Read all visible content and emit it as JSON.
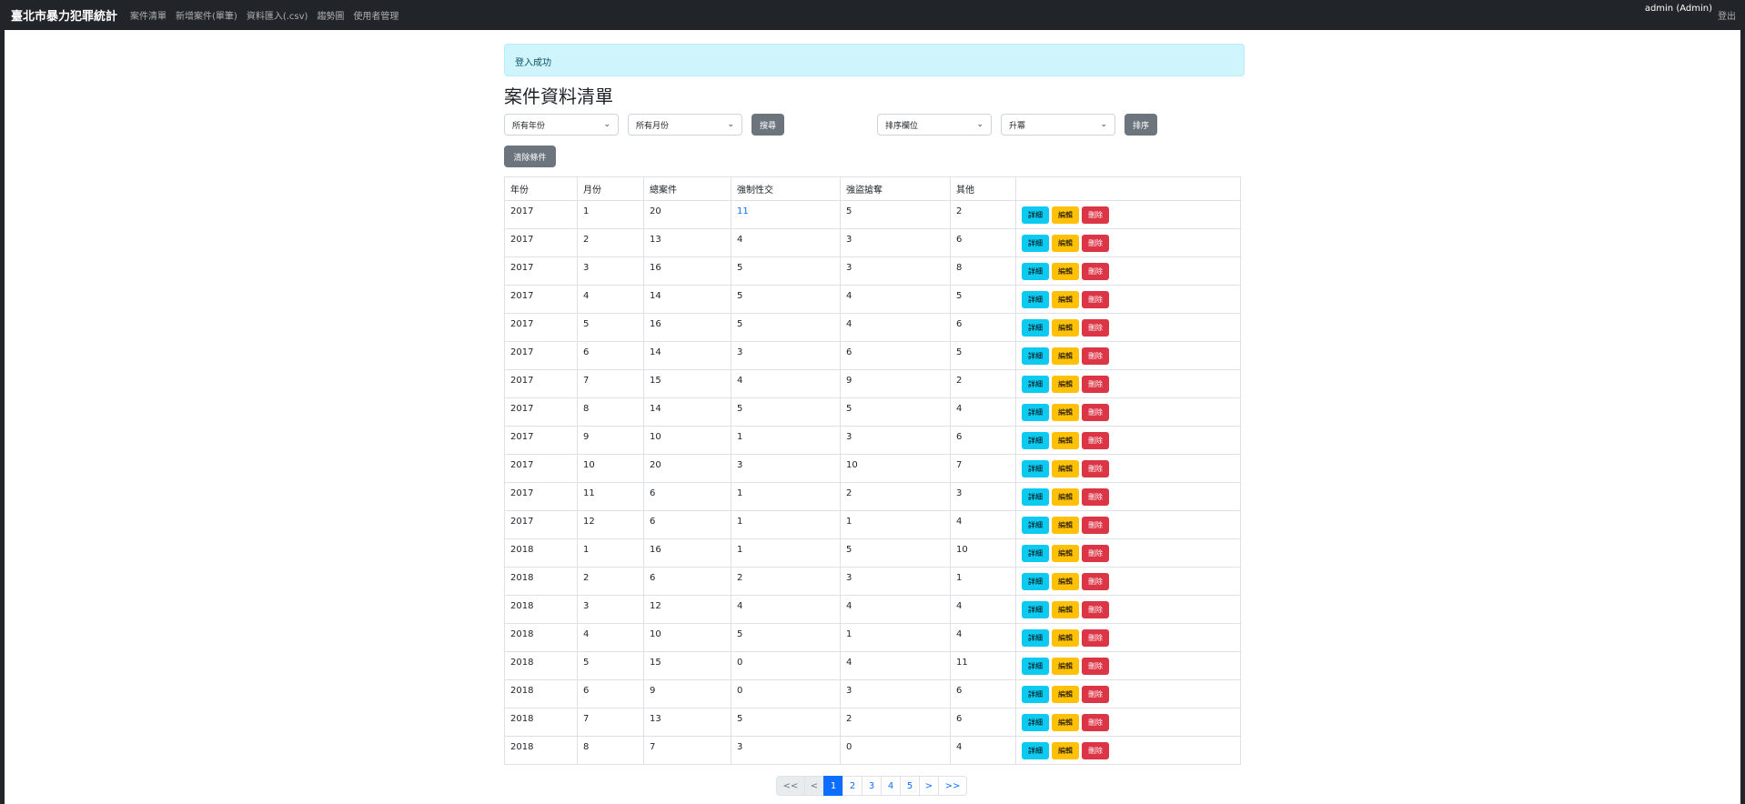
{
  "nav": {
    "brand": "臺北市暴力犯罪統計",
    "links": [
      "案件清單",
      "新增案件(單筆)",
      "資料匯入(.csv)",
      "趨勢圖",
      "使用者管理"
    ],
    "user": "admin (Admin)",
    "logout": "登出"
  },
  "alert": "登入成功",
  "title": "案件資料清單",
  "filters": {
    "year": "所有年份",
    "month": "所有月份",
    "search_label": "搜尋",
    "sort_field": "排序欄位",
    "sort_order": "升冪",
    "sort_label": "排序",
    "clear_label": "清除條件"
  },
  "table": {
    "headers": [
      "年份",
      "月份",
      "總案件",
      "強制性交",
      "強盜搶奪",
      "其他",
      ""
    ],
    "action_labels": {
      "view": "詳細",
      "edit": "編輯",
      "delete": "刪除"
    },
    "rows": [
      [
        "2017",
        "1",
        "20",
        "11",
        "5",
        "2"
      ],
      [
        "2017",
        "2",
        "13",
        "4",
        "3",
        "6"
      ],
      [
        "2017",
        "3",
        "16",
        "5",
        "3",
        "8"
      ],
      [
        "2017",
        "4",
        "14",
        "5",
        "4",
        "5"
      ],
      [
        "2017",
        "5",
        "16",
        "5",
        "4",
        "6"
      ],
      [
        "2017",
        "6",
        "14",
        "3",
        "6",
        "5"
      ],
      [
        "2017",
        "7",
        "15",
        "4",
        "9",
        "2"
      ],
      [
        "2017",
        "8",
        "14",
        "5",
        "5",
        "4"
      ],
      [
        "2017",
        "9",
        "10",
        "1",
        "3",
        "6"
      ],
      [
        "2017",
        "10",
        "20",
        "3",
        "10",
        "7"
      ],
      [
        "2017",
        "11",
        "6",
        "1",
        "2",
        "3"
      ],
      [
        "2017",
        "12",
        "6",
        "1",
        "1",
        "4"
      ],
      [
        "2018",
        "1",
        "16",
        "1",
        "5",
        "10"
      ],
      [
        "2018",
        "2",
        "6",
        "2",
        "3",
        "1"
      ],
      [
        "2018",
        "3",
        "12",
        "4",
        "4",
        "4"
      ],
      [
        "2018",
        "4",
        "10",
        "5",
        "1",
        "4"
      ],
      [
        "2018",
        "5",
        "15",
        "0",
        "4",
        "11"
      ],
      [
        "2018",
        "6",
        "9",
        "0",
        "3",
        "6"
      ],
      [
        "2018",
        "7",
        "13",
        "5",
        "2",
        "6"
      ],
      [
        "2018",
        "8",
        "7",
        "3",
        "0",
        "4"
      ]
    ]
  },
  "pagination": {
    "items": [
      "<<",
      "<",
      "1",
      "2",
      "3",
      "4",
      "5",
      ">",
      ">>"
    ],
    "active": "1"
  }
}
